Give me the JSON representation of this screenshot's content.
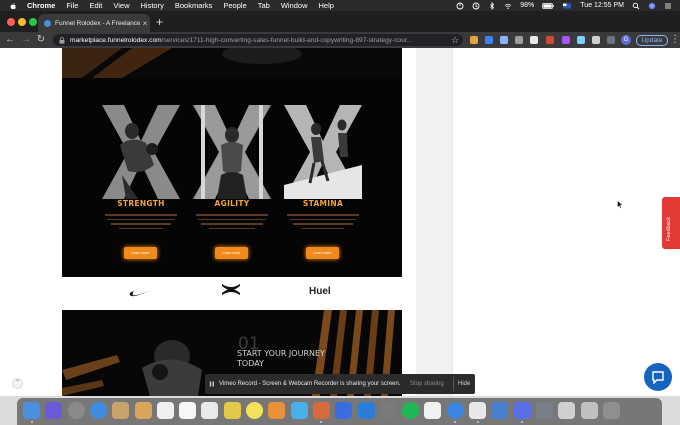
{
  "menubar": {
    "app_name": "Chrome",
    "menus": [
      "File",
      "Edit",
      "View",
      "History",
      "Bookmarks",
      "People",
      "Tab",
      "Window",
      "Help"
    ],
    "battery": "98%",
    "clock": "Tue 12:55 PM"
  },
  "tab": {
    "title": "Funnel Rolodex - A Freelance",
    "close": "×",
    "new_tab": "+"
  },
  "toolbar": {
    "back": "←",
    "forward": "→",
    "reload": "↻",
    "url_host": "marketplace.funnelrolodex.com",
    "url_path": "/services/1711-high-converting-sales-funnel-build-and-copywriting-897-strategy-cour...",
    "star": "☆",
    "avatar": "G",
    "update_label": "Update",
    "menu": "⋮"
  },
  "hero": {
    "cards": [
      {
        "label": "STRENGTH",
        "button": "Learn more"
      },
      {
        "label": "AGILITY",
        "button": "Learn more"
      },
      {
        "label": "STAMINA",
        "button": "Learn more"
      }
    ]
  },
  "brands": {
    "huel": "Huel"
  },
  "section2": {
    "number": "01",
    "title": "START YOUR JOURNEY TODAY"
  },
  "feedback": {
    "label": "Feedback"
  },
  "sharing": {
    "message": "Vimeo Record - Screen & Webcam Recorder is sharing your screen.",
    "stop_label": "Stop sharing",
    "hide_label": "Hide"
  },
  "dock": {
    "icon_colors": [
      "#4a8fe0",
      "#6a5cd8",
      "#8a8a8a",
      "#3d8de0",
      "#c8a36a",
      "#d9a55a",
      "#f0f0f0",
      "#f7f7f7",
      "#e9e9e9",
      "#e4c84a",
      "#f3e35a",
      "#e8913a",
      "#47b0e8",
      "#d66a3a",
      "#3a6ee0",
      "#2d7dd8",
      "#7a7a7a",
      "#1db954",
      "#f2f2f2",
      "#3a86e0",
      "#e8e8e8",
      "#4a7fd0",
      "#5a6ee8",
      "#7a7f8a",
      "#d0d0d0",
      "#c0c0c0",
      "#8f8f8f"
    ]
  }
}
